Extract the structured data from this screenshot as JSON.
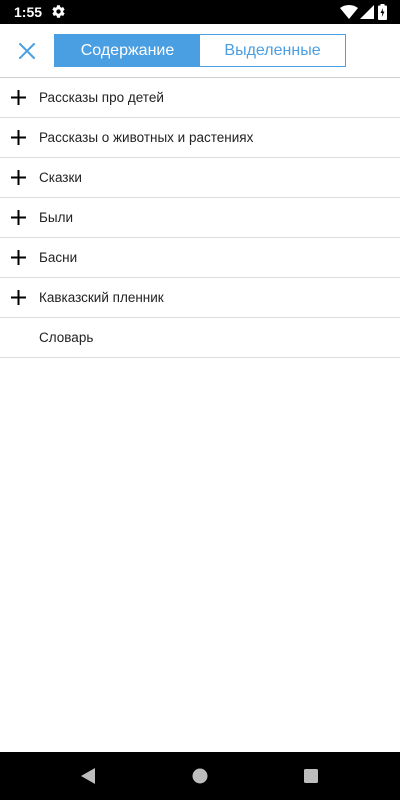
{
  "status_bar": {
    "time": "1:55",
    "icons": [
      "gear-icon",
      "wifi-icon",
      "signal-icon",
      "battery-icon"
    ]
  },
  "header": {
    "close_icon": "close-icon",
    "tabs": [
      {
        "label": "Содержание",
        "active": true
      },
      {
        "label": "Выделенные",
        "active": false
      }
    ],
    "accent_color": "#4a9ee2"
  },
  "toc": {
    "items": [
      {
        "label": "Рассказы про детей",
        "expandable": true
      },
      {
        "label": "Рассказы о животных и растениях",
        "expandable": true
      },
      {
        "label": "Сказки",
        "expandable": true
      },
      {
        "label": "Были",
        "expandable": true
      },
      {
        "label": "Басни",
        "expandable": true
      },
      {
        "label": "Кавказский пленник",
        "expandable": true
      },
      {
        "label": "Словарь",
        "expandable": false
      }
    ]
  },
  "nav_bar": {
    "icons": [
      "back-icon",
      "home-icon",
      "recents-icon"
    ]
  }
}
